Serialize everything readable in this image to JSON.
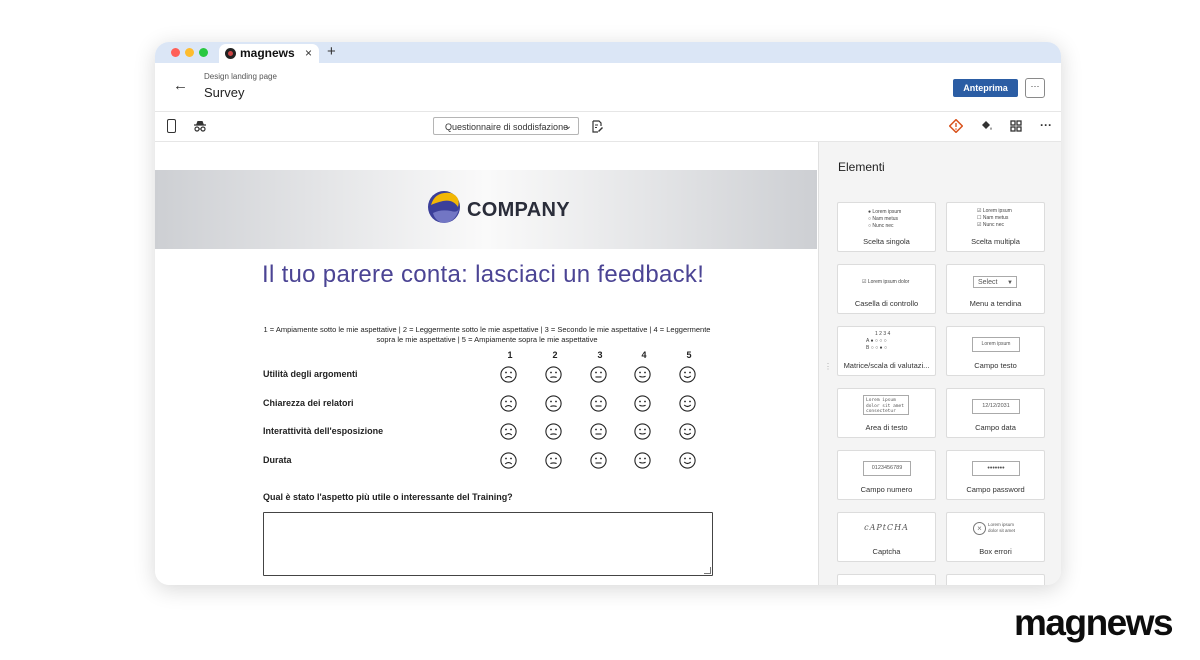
{
  "browser": {
    "tab_title": "magnews",
    "close_glyph": "×",
    "new_tab_glyph": "+"
  },
  "header": {
    "breadcrumb": "Design landing page",
    "title": "Survey",
    "preview_label": "Anteprima",
    "more_glyph": "···",
    "back_glyph": "←"
  },
  "toolbar": {
    "questionnaire_select": "Questionnaire di soddisfazione",
    "more_glyph": "···"
  },
  "landing": {
    "logo_text": "COMPANY",
    "title": "Il tuo parere conta: lasciaci un feedback!",
    "scale_description": "1 = Ampiamente sotto le mie aspettative | 2 = Leggermente sotto le mie aspettative | 3 = Secondo le mie aspettative | 4 = Leggermente sopra le mie aspettative | 5 = Ampiamente sopra le mie aspettative",
    "scale_numbers": [
      "1",
      "2",
      "3",
      "4",
      "5"
    ],
    "questions": [
      "Utilità degli argomenti",
      "Chiarezza dei relatori",
      "Interattività dell'esposizione",
      "Durata"
    ],
    "open_question": "Qual è stato l'aspetto più utile o interessante del Training?"
  },
  "panel": {
    "title": "Elementi",
    "elements": [
      {
        "label": "Scelta singola",
        "thumb": "radio"
      },
      {
        "label": "Scelta multipla",
        "thumb": "checkbox"
      },
      {
        "label": "Casella di controllo",
        "thumb": "single-check"
      },
      {
        "label": "Menu a tendina",
        "thumb": "dropdown"
      },
      {
        "label": "Matrice/scala di valutazi...",
        "thumb": "matrix"
      },
      {
        "label": "Campo testo",
        "thumb": "text"
      },
      {
        "label": "Area di testo",
        "thumb": "textarea"
      },
      {
        "label": "Campo data",
        "thumb": "date"
      },
      {
        "label": "Campo numero",
        "thumb": "number"
      },
      {
        "label": "Campo password",
        "thumb": "password"
      },
      {
        "label": "Captcha",
        "thumb": "captcha"
      },
      {
        "label": "Box errori",
        "thumb": "error"
      }
    ],
    "thumb_text": {
      "lorem": "Lorem ipsum",
      "nam": "Nam metus",
      "nunc": "Nunc nec",
      "lorem_dolor": "Lorem ipsum dolor",
      "select": "Select",
      "textarea_text": "Lorem ipsum dolor sit amet consectetur",
      "date": "12/12/2031",
      "number": "0123456789",
      "password": "•••••••",
      "captcha": "cAPtCHA",
      "error_text": "Lorem ipsum dolor sit amet",
      "matrix_cols": "1 2 3 4",
      "matrix_a": "A",
      "matrix_b": "B"
    }
  },
  "brand": {
    "wordmark": "magnews"
  },
  "colors": {
    "accent": "#2b5da4",
    "title": "#4b4494",
    "tabbar": "#dbe6f6",
    "warning": "#d9541e"
  }
}
